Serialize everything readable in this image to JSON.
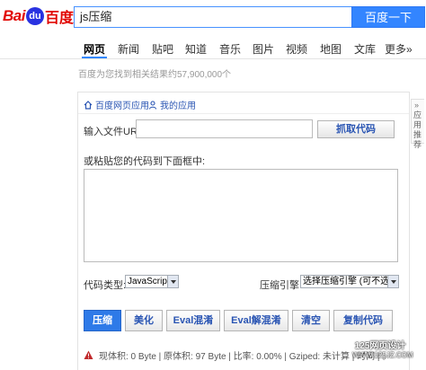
{
  "header": {
    "logo_left": "Bai",
    "logo_mark": "du",
    "logo_right": "百度",
    "query": "js压缩",
    "search_button": "百度一下"
  },
  "nav": {
    "items": [
      "网页",
      "新闻",
      "贴吧",
      "知道",
      "音乐",
      "图片",
      "视频",
      "地图",
      "文库",
      "更多»"
    ],
    "active": "网页"
  },
  "result_count": "百度为您找到相关结果约57,900,000个",
  "panel": {
    "links": [
      "百度网页应用",
      "我的应用"
    ],
    "url_label": "输入文件URL:",
    "fetch_button": "抓取代码",
    "paste_label": "或粘贴您的代码到下面框中:",
    "code_type_label": "代码类型:",
    "code_type_value": "JavaScript",
    "engine_label": "压缩引擎:",
    "engine_value": "选择压缩引擎 (可不选)",
    "actions": [
      "压缩",
      "美化",
      "Eval混淆",
      "Eval解混淆",
      "清空",
      "复制代码"
    ],
    "status": "现体积: 0 Byte | 原体积: 97 Byte | 比率: 0.00% | Gziped: 未计算 | 时间 | 。"
  },
  "side_tab": {
    "text": "应用推荐"
  },
  "watermark": {
    "line1": "125网页设计",
    "line2": "WWW.125JZ.COM"
  },
  "colors": {
    "brand_red": "#e10602",
    "brand_blue": "#2932e1",
    "search_blue": "#3385ff",
    "link_blue": "#2a55b3",
    "primary_button": "#2e7ae8"
  }
}
